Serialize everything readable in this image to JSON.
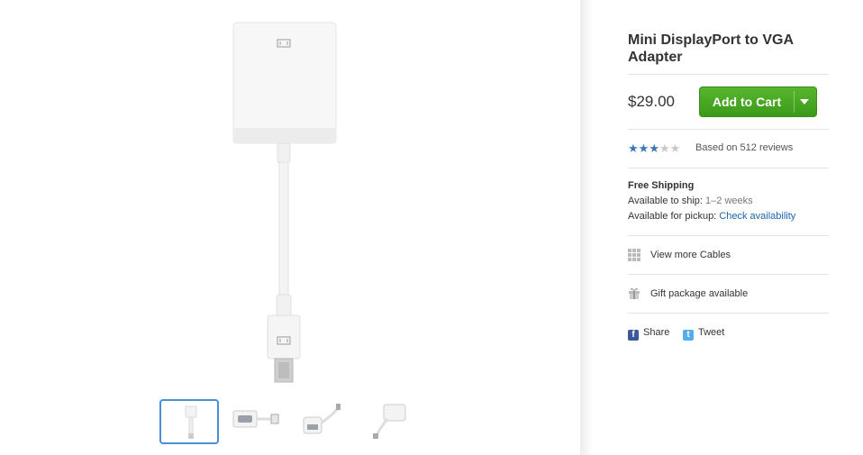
{
  "product": {
    "title": "Mini DisplayPort to VGA Adapter",
    "price": "$29.00"
  },
  "cart": {
    "label": "Add to Cart",
    "accent_color": "#3a9a18"
  },
  "rating": {
    "stars_filled": 3,
    "stars_total": 5,
    "reviews_text": "Based on 512 reviews",
    "star_color": "#3d77b8"
  },
  "shipping": {
    "heading": "Free Shipping",
    "ship_label": "Available to ship:",
    "ship_value": "1–2 weeks",
    "pickup_label": "Available for pickup:",
    "pickup_link": "Check availability"
  },
  "extras": {
    "cables_label": "View more Cables",
    "cables_icon": "grid-icon",
    "gift_label": "Gift package available",
    "gift_icon": "gift-icon"
  },
  "social": {
    "share_label": "Share",
    "tweet_label": "Tweet",
    "facebook_icon": "f",
    "twitter_icon": "t"
  },
  "gallery": {
    "thumbnail_count": 4,
    "selected_index": 0,
    "selected_border_color": "#4a90d9"
  }
}
